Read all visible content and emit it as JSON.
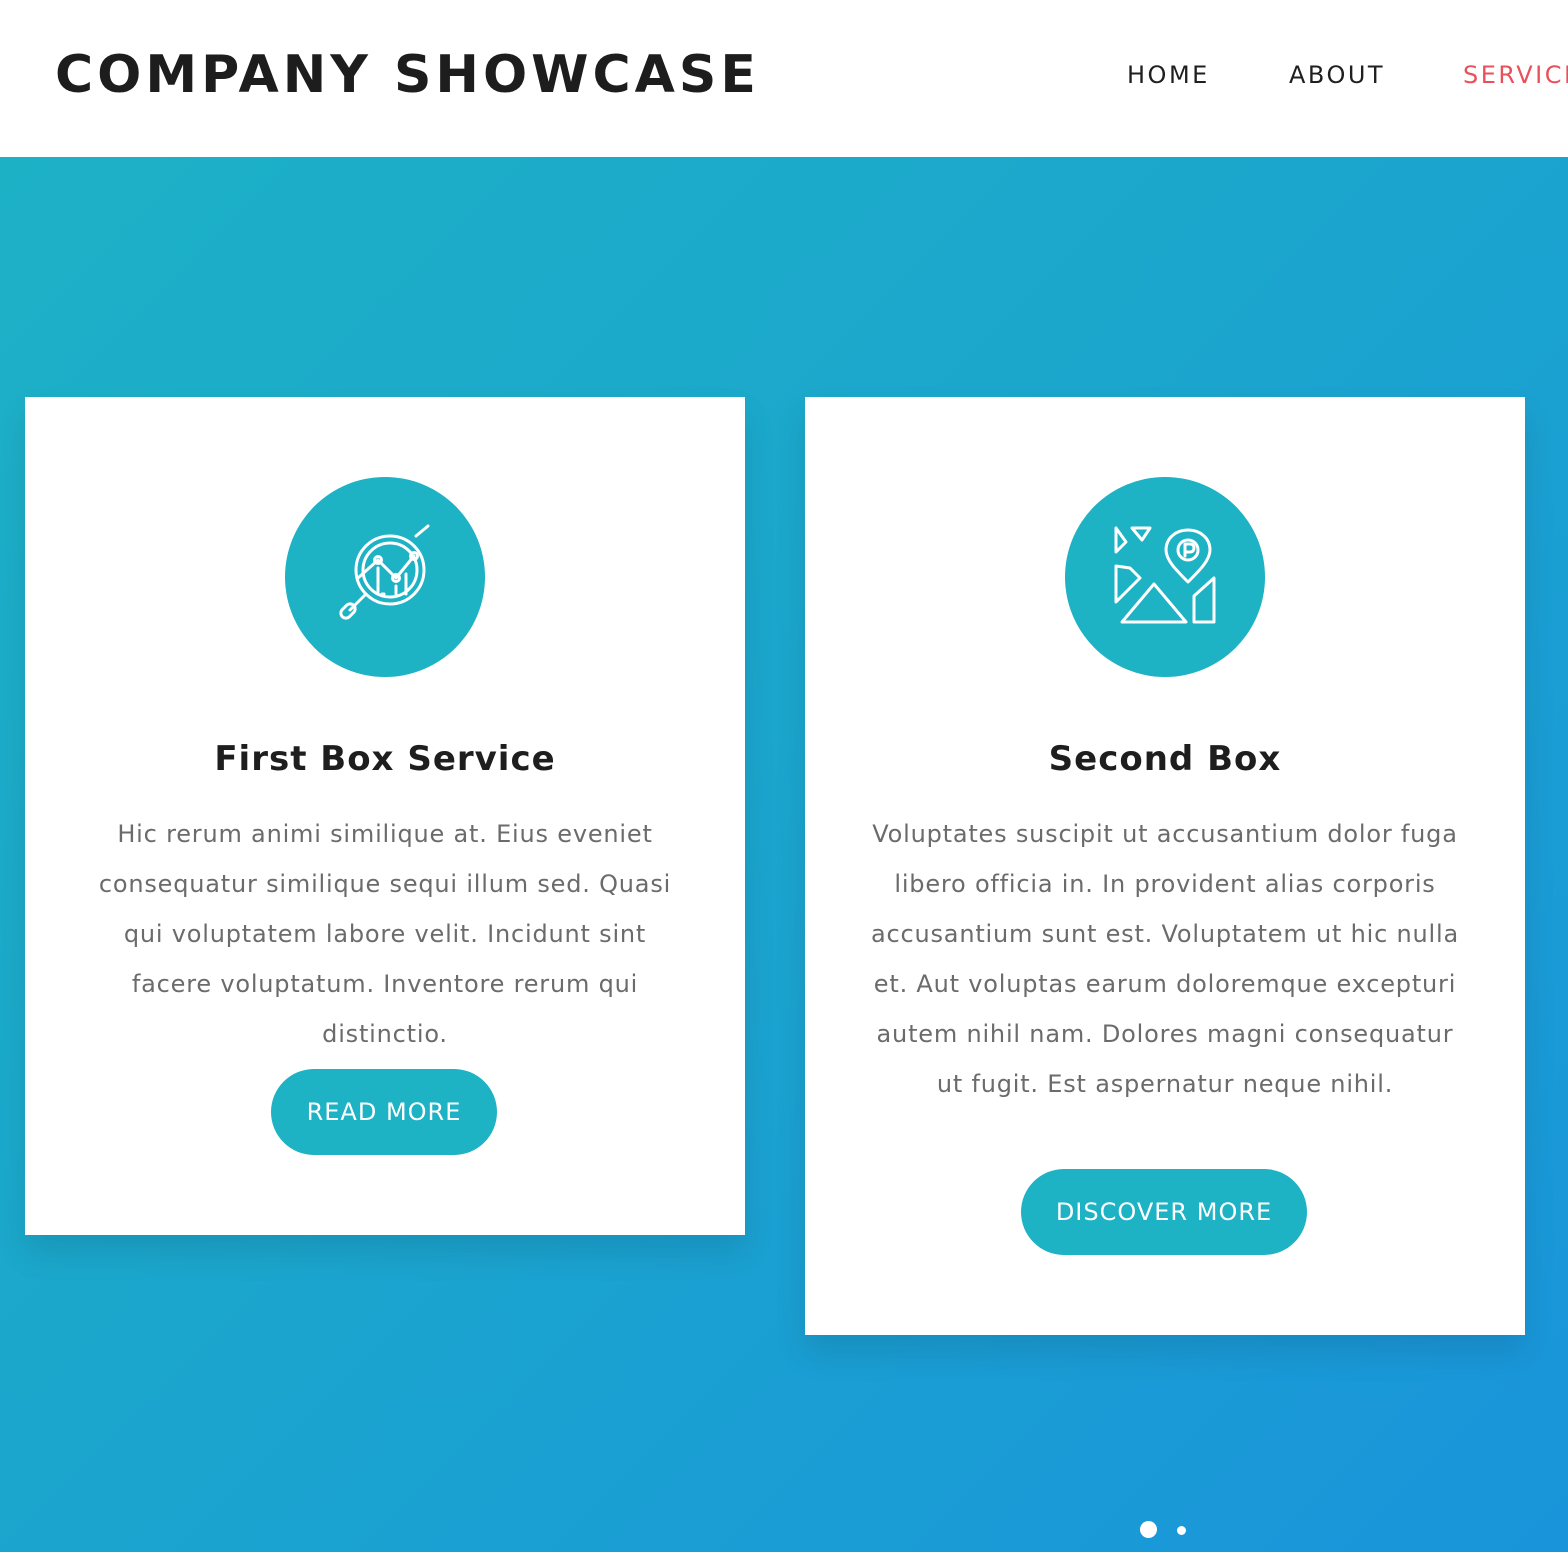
{
  "header": {
    "brand": "COMPANY SHOWCASE",
    "nav": {
      "home": "HOME",
      "about": "ABOUT",
      "services": "SERVICES"
    }
  },
  "colors": {
    "accent": "#1db2c4",
    "active_nav": "#e8515a",
    "gradient_start": "#1db1c6",
    "gradient_end": "#1994db"
  },
  "cards": [
    {
      "icon": "analytics-magnifier-icon",
      "title": "First Box Service",
      "text": "Hic rerum animi similique at. Eius eveniet consequatur similique sequi illum sed. Quasi qui voluptatem labore velit. Incidunt sint facere voluptatum. Inventore rerum qui distinctio.",
      "button": "READ MORE"
    },
    {
      "icon": "map-parking-pin-icon",
      "title": "Second Box",
      "text": "Voluptates suscipit ut accusantium dolor fuga libero officia in. In provident alias corporis accusantium sunt est. Voluptatem ut hic nulla et. Aut voluptas earum doloremque excepturi autem nihil nam. Dolores magni consequatur ut fugit. Est aspernatur neque nihil.",
      "button": "DISCOVER MORE"
    }
  ],
  "carousel": {
    "active_index": 0,
    "total": 2
  }
}
